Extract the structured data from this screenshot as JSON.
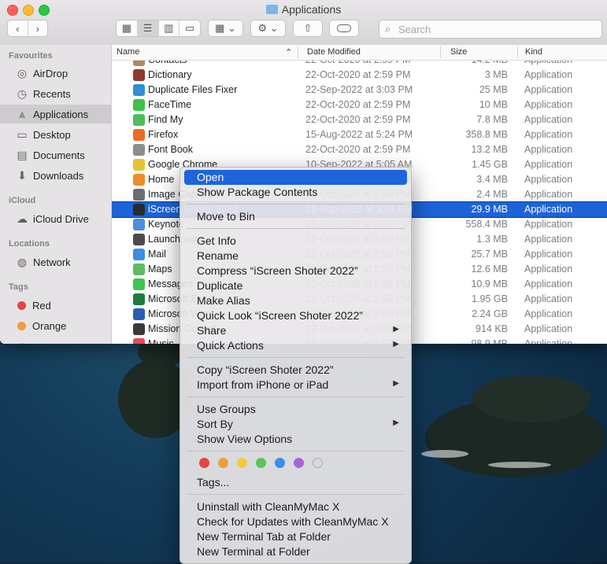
{
  "window": {
    "title": "Applications"
  },
  "toolbar": {
    "back_icon": "chevron-left-icon",
    "forward_icon": "chevron-right-icon",
    "search_placeholder": "Search"
  },
  "sidebar": {
    "sections": [
      {
        "label": "Favourites"
      },
      {
        "label": "iCloud"
      },
      {
        "label": "Locations"
      },
      {
        "label": "Tags"
      }
    ],
    "items": [
      {
        "label": "AirDrop",
        "icon": "airdrop-icon"
      },
      {
        "label": "Recents",
        "icon": "clock-icon"
      },
      {
        "label": "Applications",
        "icon": "applications-icon"
      },
      {
        "label": "Desktop",
        "icon": "desktop-icon"
      },
      {
        "label": "Documents",
        "icon": "document-icon"
      },
      {
        "label": "Downloads",
        "icon": "download-icon"
      },
      {
        "label": "iCloud Drive",
        "icon": "cloud-icon"
      },
      {
        "label": "Network",
        "icon": "globe-icon"
      },
      {
        "label": "Red",
        "color": "#e5453d"
      },
      {
        "label": "Orange",
        "color": "#f29c38"
      }
    ]
  },
  "columns": {
    "name": "Name",
    "date": "Date Modified",
    "size": "Size",
    "kind": "Kind"
  },
  "files": [
    {
      "name": "Contacts",
      "date": "22-Oct-2020 at 2:59 PM",
      "size": "14.2 MB",
      "kind": "Application",
      "color": "#b8865a"
    },
    {
      "name": "Dictionary",
      "date": "22-Oct-2020 at 2:59 PM",
      "size": "3 MB",
      "kind": "Application",
      "color": "#8c3a2f"
    },
    {
      "name": "Duplicate Files Fixer",
      "date": "22-Sep-2022 at 3:03 PM",
      "size": "25 MB",
      "kind": "Application",
      "color": "#2f8fd8"
    },
    {
      "name": "FaceTime",
      "date": "22-Oct-2020 at 2:59 PM",
      "size": "10 MB",
      "kind": "Application",
      "color": "#3cc24a"
    },
    {
      "name": "Find My",
      "date": "22-Oct-2020 at 2:59 PM",
      "size": "7.8 MB",
      "kind": "Application",
      "color": "#4cbf5a"
    },
    {
      "name": "Firefox",
      "date": "15-Aug-2022 at 5:24 PM",
      "size": "358.8 MB",
      "kind": "Application",
      "color": "#ef6a24"
    },
    {
      "name": "Font Book",
      "date": "22-Oct-2020 at 2:59 PM",
      "size": "13.2 MB",
      "kind": "Application",
      "color": "#8d8d8d"
    },
    {
      "name": "Google Chrome",
      "date": "10-Sep-2022 at 5:05 AM",
      "size": "1.45 GB",
      "kind": "Application",
      "color": "#e6c230"
    },
    {
      "name": "Home",
      "date": "22-Oct-2020 at 2:59 PM",
      "size": "3.4 MB",
      "kind": "Application",
      "color": "#f08a2c"
    },
    {
      "name": "Image Capture",
      "date": "22-Oct-2020 at 2:59 PM",
      "size": "2.4 MB",
      "kind": "Application",
      "color": "#6d6d6d"
    },
    {
      "name": "iScreen Shoter 2022",
      "date": "22-Sep-2022 at 3:03 PM",
      "size": "29.9 MB",
      "kind": "Application",
      "color": "#2b2b2b",
      "selected": true
    },
    {
      "name": "Keynote",
      "date": "22-Oct-2020 at 2:59 PM",
      "size": "558.4 MB",
      "kind": "Application",
      "color": "#4a8ee0"
    },
    {
      "name": "Launchpad",
      "date": "22-Oct-2020 at 2:59 PM",
      "size": "1.3 MB",
      "kind": "Application",
      "color": "#4b4b4b"
    },
    {
      "name": "Mail",
      "date": "22-Oct-2020 at 2:59 PM",
      "size": "25.7 MB",
      "kind": "Application",
      "color": "#3b8de4"
    },
    {
      "name": "Maps",
      "date": "22-Oct-2020 at 2:59 PM",
      "size": "12.6 MB",
      "kind": "Application",
      "color": "#5dbb63"
    },
    {
      "name": "Messages",
      "date": "22-Oct-2020 at 2:59 PM",
      "size": "10.9 MB",
      "kind": "Application",
      "color": "#3ec451"
    },
    {
      "name": "Microsoft Excel",
      "date": "22-Oct-2020 at 2:59 PM",
      "size": "1.95 GB",
      "kind": "Application",
      "color": "#1f7a42"
    },
    {
      "name": "Microsoft Word",
      "date": "22-Oct-2020 at 2:59 PM",
      "size": "2.24 GB",
      "kind": "Application",
      "color": "#2b5cb8"
    },
    {
      "name": "Mission Control",
      "date": "22-Oct-2020 at 2:59 PM",
      "size": "914 KB",
      "kind": "Application",
      "color": "#3a3a3a"
    },
    {
      "name": "Music",
      "date": "22-Oct-2020 at 2:59 PM",
      "size": "98.9 MB",
      "kind": "Application",
      "color": "#f2445a"
    }
  ],
  "menu": {
    "items": [
      {
        "label": "Open",
        "highlight": true
      },
      {
        "label": "Show Package Contents"
      },
      {
        "sep": true
      },
      {
        "label": "Move to Bin"
      },
      {
        "sep": true
      },
      {
        "label": "Get Info"
      },
      {
        "label": "Rename"
      },
      {
        "label": "Compress “iScreen Shoter 2022”"
      },
      {
        "label": "Duplicate"
      },
      {
        "label": "Make Alias"
      },
      {
        "label": "Quick Look “iScreen Shoter 2022”"
      },
      {
        "label": "Share",
        "submenu": true
      },
      {
        "label": "Quick Actions",
        "submenu": true
      },
      {
        "sep": true
      },
      {
        "label": "Copy “iScreen Shoter 2022”"
      },
      {
        "label": "Import from iPhone or iPad",
        "submenu": true
      },
      {
        "sep": true
      },
      {
        "label": "Use Groups"
      },
      {
        "label": "Sort By",
        "submenu": true
      },
      {
        "label": "Show View Options"
      },
      {
        "sep": true
      },
      {
        "tags": true
      },
      {
        "label": "Tags..."
      },
      {
        "sep": true
      },
      {
        "label": "Uninstall with CleanMyMac X"
      },
      {
        "label": "Check for Updates with CleanMyMac X"
      },
      {
        "label": "New Terminal Tab at Folder"
      },
      {
        "label": "New Terminal at Folder"
      }
    ],
    "tag_colors": [
      "#e5453d",
      "#f29c38",
      "#f4c93c",
      "#5bc557",
      "#3d8ee8",
      "#a864d4",
      "#a9a9a9"
    ]
  }
}
